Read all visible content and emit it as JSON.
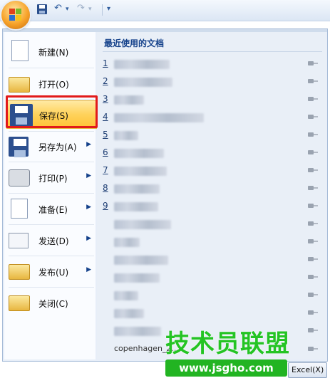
{
  "toolbar": {
    "undo_glyph": "↶",
    "redo_glyph": "↷",
    "dropdown_glyph": "▾",
    "customize_glyph": "≡"
  },
  "menu": {
    "items": [
      {
        "label": "新建(N)",
        "icon": "new-document-icon",
        "has_submenu": false
      },
      {
        "label": "打开(O)",
        "icon": "open-folder-icon",
        "has_submenu": false
      },
      {
        "label": "保存(S)",
        "icon": "save-icon",
        "has_submenu": false,
        "active": true
      },
      {
        "label": "另存为(A)",
        "icon": "save-as-icon",
        "has_submenu": true
      },
      {
        "label": "打印(P)",
        "icon": "print-icon",
        "has_submenu": true
      },
      {
        "label": "准备(E)",
        "icon": "prepare-icon",
        "has_submenu": true
      },
      {
        "label": "发送(D)",
        "icon": "send-icon",
        "has_submenu": true
      },
      {
        "label": "发布(U)",
        "icon": "publish-icon",
        "has_submenu": true
      },
      {
        "label": "关闭(C)",
        "icon": "close-folder-icon",
        "has_submenu": false
      }
    ],
    "submenu_arrow": "▶"
  },
  "recent": {
    "title": "最近使用的文档",
    "numbers": [
      "1",
      "2",
      "3",
      "4",
      "5",
      "6",
      "7",
      "8",
      "9"
    ],
    "last_item_text": "copenhagen_2..."
  },
  "bottom": {
    "options_label": "Excel(X)"
  },
  "watermark": {
    "text": "技术员联盟",
    "url": "www.jsgho.com"
  },
  "colors": {
    "accent": "#15428b",
    "highlight_border": "#e21a1a",
    "active_fill": "#ffd25a",
    "watermark_green": "#24c424"
  }
}
